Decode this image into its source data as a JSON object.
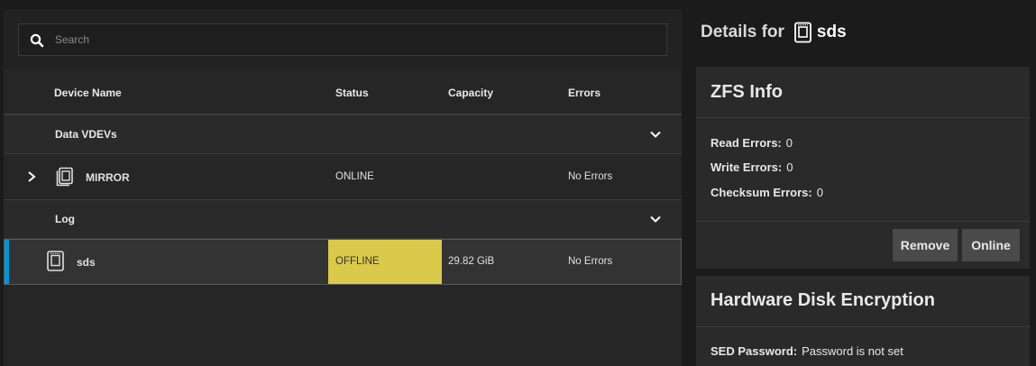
{
  "search": {
    "placeholder": "Search"
  },
  "table": {
    "columns": [
      "Device Name",
      "Status",
      "Capacity",
      "Errors"
    ],
    "groups": [
      {
        "label": "Data VDEVs",
        "rows": [
          {
            "name": "MIRROR",
            "status": "ONLINE",
            "capacity": "",
            "errors": "No Errors"
          }
        ]
      },
      {
        "label": "Log",
        "rows": [
          {
            "name": "sds",
            "status": "OFFLINE",
            "capacity": "29.82 GiB",
            "errors": "No Errors"
          }
        ]
      }
    ]
  },
  "details": {
    "title_prefix": "Details for",
    "device": "sds",
    "zfs": {
      "title": "ZFS Info",
      "read_label": "Read Errors:",
      "read_value": "0",
      "write_label": "Write Errors:",
      "write_value": "0",
      "checksum_label": "Checksum Errors:",
      "checksum_value": "0",
      "remove_label": "Remove",
      "online_label": "Online"
    },
    "hde": {
      "title": "Hardware Disk Encryption",
      "sed_label": "SED Password:",
      "sed_value": "Password is not set"
    }
  },
  "colors": {
    "accent": "#0095d5",
    "offline": "#dac94a"
  }
}
